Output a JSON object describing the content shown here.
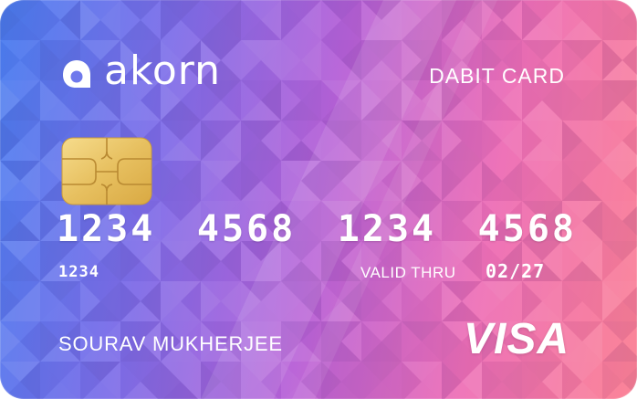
{
  "card": {
    "brand_name": "akorn",
    "card_type": "DABIT CARD",
    "number_groups": [
      "1234",
      "4568",
      "1234",
      "4568"
    ],
    "small_number": "1234",
    "valid_thru_label": "VALID THRU",
    "valid_thru_value": "02/27",
    "holder_name": "SOURAV MUKHERJEE",
    "network": "VISA"
  },
  "colors": {
    "gradient_start": "#4a7ef0",
    "gradient_mid": "#b762d8",
    "gradient_end": "#fb7f93",
    "chip": "#e9c46a",
    "text": "#ffffff"
  },
  "icons": {
    "logo": "akorn-logo-icon",
    "chip": "emv-chip-icon"
  }
}
